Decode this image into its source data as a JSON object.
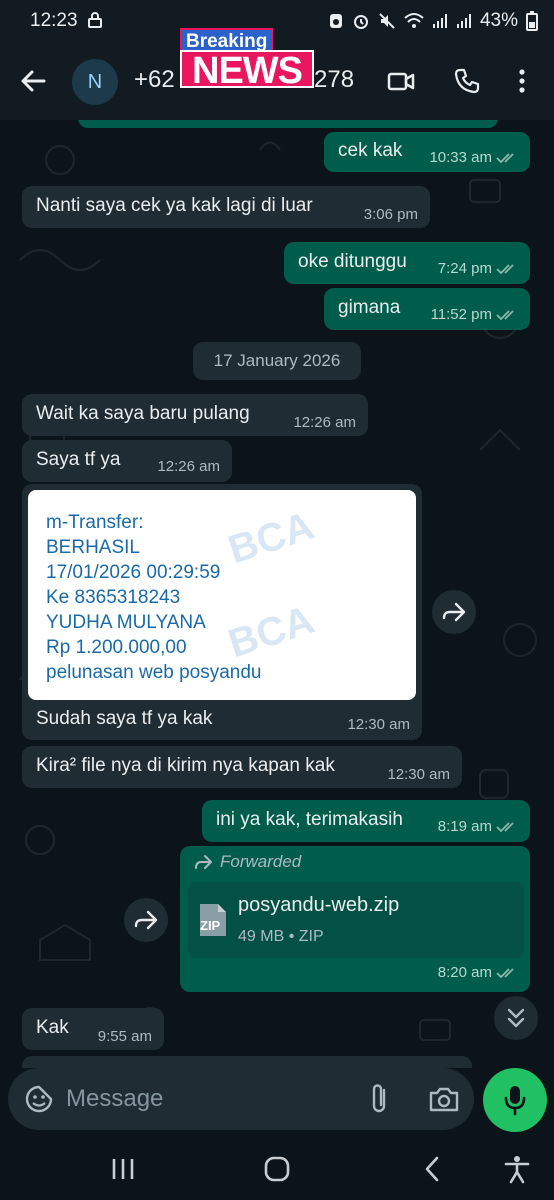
{
  "status_bar": {
    "time": "12:23",
    "battery": "43%"
  },
  "header": {
    "avatar_letter": "N",
    "contact_prefix": "+62",
    "contact_suffix": "278",
    "overlay_top": "Breaking",
    "overlay_main": "NEWS"
  },
  "messages": [
    {
      "dir": "out",
      "text": "cek kak",
      "time": "10:33 am"
    },
    {
      "dir": "in",
      "text": "Nanti saya cek ya kak lagi di luar",
      "time": "3:06 pm"
    },
    {
      "dir": "out",
      "text": "oke ditunggu",
      "time": "7:24 pm"
    },
    {
      "dir": "out",
      "text": "gimana",
      "time": "11:52 pm"
    },
    {
      "dir": "in",
      "text": "Wait ka saya baru pulang",
      "time": "12:26 am"
    },
    {
      "dir": "in",
      "text": "Saya tf ya",
      "time": "12:26 am"
    },
    {
      "dir": "in",
      "text": "Sudah saya tf ya kak",
      "time": "12:30 am"
    },
    {
      "dir": "in",
      "text": "Kira² file nya di kirim nya kapan kak",
      "time": "12:30 am"
    },
    {
      "dir": "out",
      "text": "ini ya kak, terimakasih",
      "time": "8:19 am"
    },
    {
      "dir": "in",
      "text": "Kak",
      "time": "9:55 am"
    }
  ],
  "date_chip": "17 January 2026",
  "transfer_image": {
    "lines": [
      "m-Transfer:",
      "BERHASIL",
      "17/01/2026 00:29:59",
      "Ke 8365318243",
      "YUDHA MULYANA",
      "Rp 1.200.000,00",
      "pelunasan web posyandu"
    ],
    "watermark": "BCA"
  },
  "file_message": {
    "forwarded_label": "Forwarded",
    "file_name": "posyandu-web.zip",
    "file_icon_label": "ZIP",
    "file_info": "49 MB • ZIP",
    "time": "8:20 am"
  },
  "input": {
    "placeholder": "Message"
  },
  "colors": {
    "incoming": "#202c33",
    "outgoing": "#005c4b",
    "mic": "#21c063",
    "background": "#0b141a"
  },
  "icons": [
    "back-arrow-icon",
    "video-call-icon",
    "phone-icon",
    "more-options-icon",
    "emoji-sticker-icon",
    "attach-icon",
    "camera-icon",
    "mic-icon",
    "forward-icon",
    "double-tick-icon",
    "scroll-down-icon"
  ]
}
